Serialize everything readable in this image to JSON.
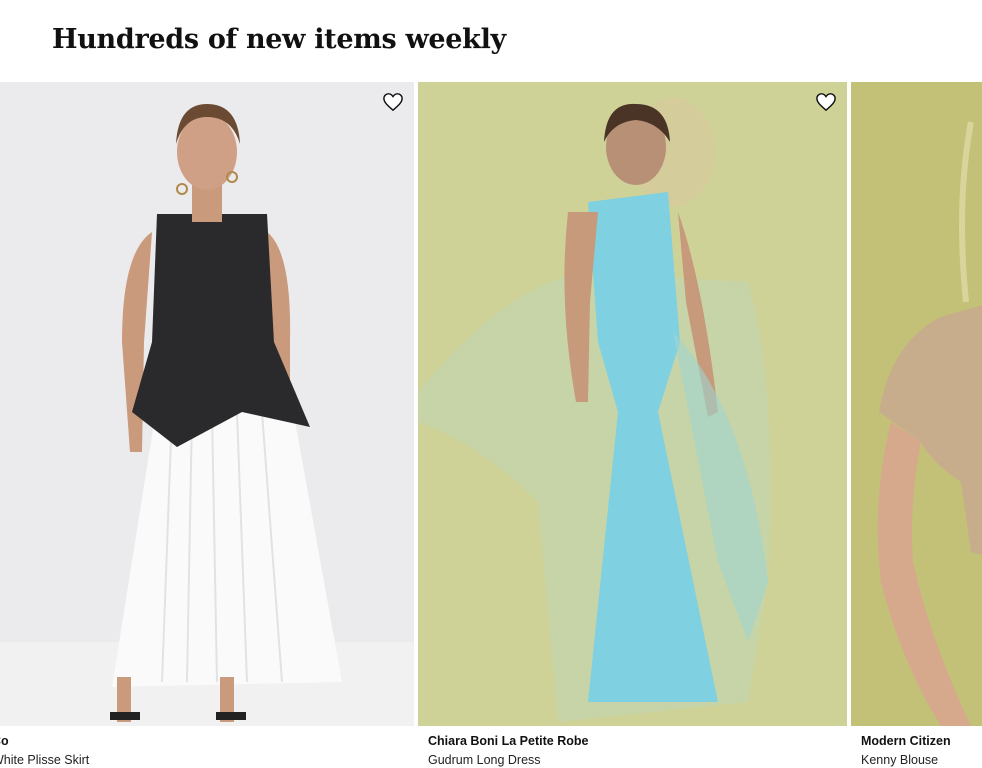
{
  "section": {
    "title": "Hundreds of new items weekly"
  },
  "products": [
    {
      "brand": "Co",
      "name": "White Plisse Skirt"
    },
    {
      "brand": "Chiara Boni La Petite Robe",
      "name": "Gudrum Long Dress"
    },
    {
      "brand": "Modern Citizen",
      "name": "Kenny Blouse"
    }
  ],
  "icons": {
    "favorite": "heart-outline-icon"
  },
  "colors": {
    "photo1_bg": "#ebebed",
    "photo2_bg": "#cfd297",
    "photo3_bg": "#c3c078",
    "dress_blue": "#7fd0e0",
    "top_black": "#2a2a2c",
    "skirt_white": "#fafafa"
  }
}
